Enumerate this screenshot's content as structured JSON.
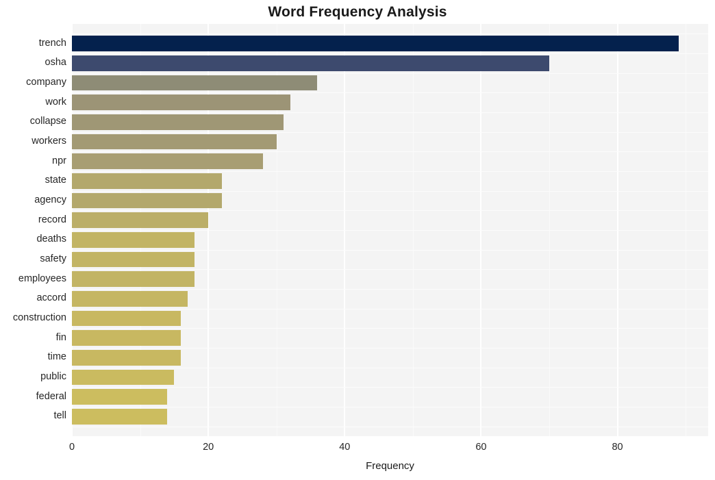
{
  "chart_data": {
    "type": "bar",
    "orientation": "horizontal",
    "title": "Word Frequency Analysis",
    "xlabel": "Frequency",
    "ylabel": "",
    "categories": [
      "trench",
      "osha",
      "company",
      "work",
      "collapse",
      "workers",
      "npr",
      "state",
      "agency",
      "record",
      "deaths",
      "safety",
      "employees",
      "accord",
      "construction",
      "fin",
      "time",
      "public",
      "federal",
      "tell"
    ],
    "values": [
      89,
      70,
      36,
      32,
      31,
      30,
      28,
      22,
      22,
      20,
      18,
      18,
      18,
      17,
      16,
      16,
      16,
      15,
      14,
      14
    ],
    "bar_colors": [
      "#04214d",
      "#3d4a6e",
      "#8e8c76",
      "#9c9476",
      "#9f9775",
      "#a39a74",
      "#a89e73",
      "#b3a86c",
      "#b3a86c",
      "#bbae68",
      "#c2b464",
      "#c2b464",
      "#c2b464",
      "#c5b663",
      "#c8b861",
      "#c8b861",
      "#c8b861",
      "#cabb60",
      "#ccbd5f",
      "#ccbd5f"
    ],
    "xlim": [
      0,
      93.3
    ],
    "x_ticks": [
      0,
      20,
      40,
      60,
      80
    ],
    "x_tick_labels": [
      "0",
      "20",
      "40",
      "60",
      "80"
    ],
    "grid": true,
    "grid_color": "#ffffff",
    "plot_background": "#f4f4f4",
    "figure_background": "#ffffff",
    "legend": null
  }
}
